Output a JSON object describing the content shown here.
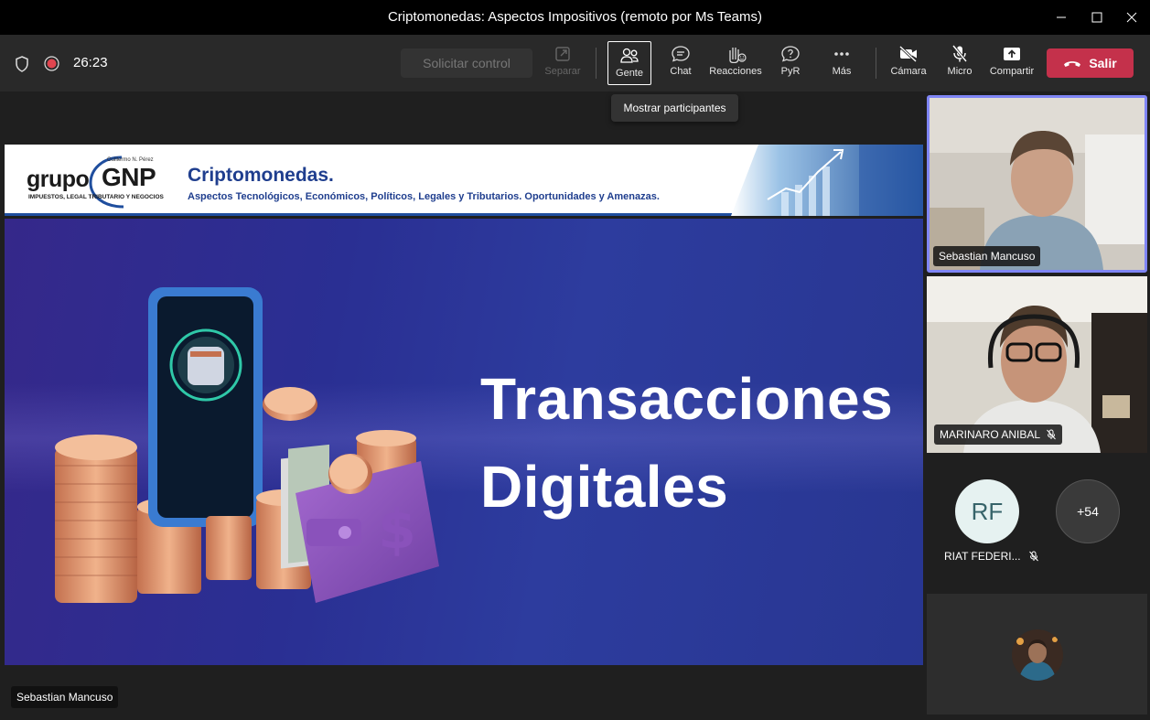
{
  "window": {
    "title": "Criptomonedas: Aspectos Impositivos (remoto por Ms Teams)"
  },
  "toolbar": {
    "timer": "26:23",
    "solicitar_control": "Solicitar control",
    "separar": "Separar",
    "gente": "Gente",
    "chat": "Chat",
    "reacciones": "Reacciones",
    "pyr": "PyR",
    "mas": "Más",
    "camara": "Cámara",
    "micro": "Micro",
    "compartir": "Compartir",
    "salir": "Salir"
  },
  "tooltip": "Mostrar participantes",
  "slide": {
    "logo_main": "grupo",
    "logo_brand": "GNP",
    "logo_top": "Guillermo N. Pérez",
    "logo_sub": "IMPUESTOS, LEGAL TRIBUTARIO Y NEGOCIOS",
    "header_title": "Criptomonedas.",
    "header_subtitle": "Aspectos Tecnológicos, Económicos, Políticos, Legales y Tributarios. Oportunidades y Amenazas.",
    "line1": "Transacciones",
    "line2": "Digitales"
  },
  "stage": {
    "presenter": "Sebastian Mancuso"
  },
  "participants": {
    "p1": "Sebastian Mancuso",
    "p2": "MARINARO ANIBAL",
    "p3_initials": "RF",
    "p3_name": "RIAT FEDERI...",
    "more": "+54"
  },
  "colors": {
    "leave": "#c4314b",
    "active_speaker": "#7f85f5",
    "avatar_rf": "#e6f2f1"
  }
}
